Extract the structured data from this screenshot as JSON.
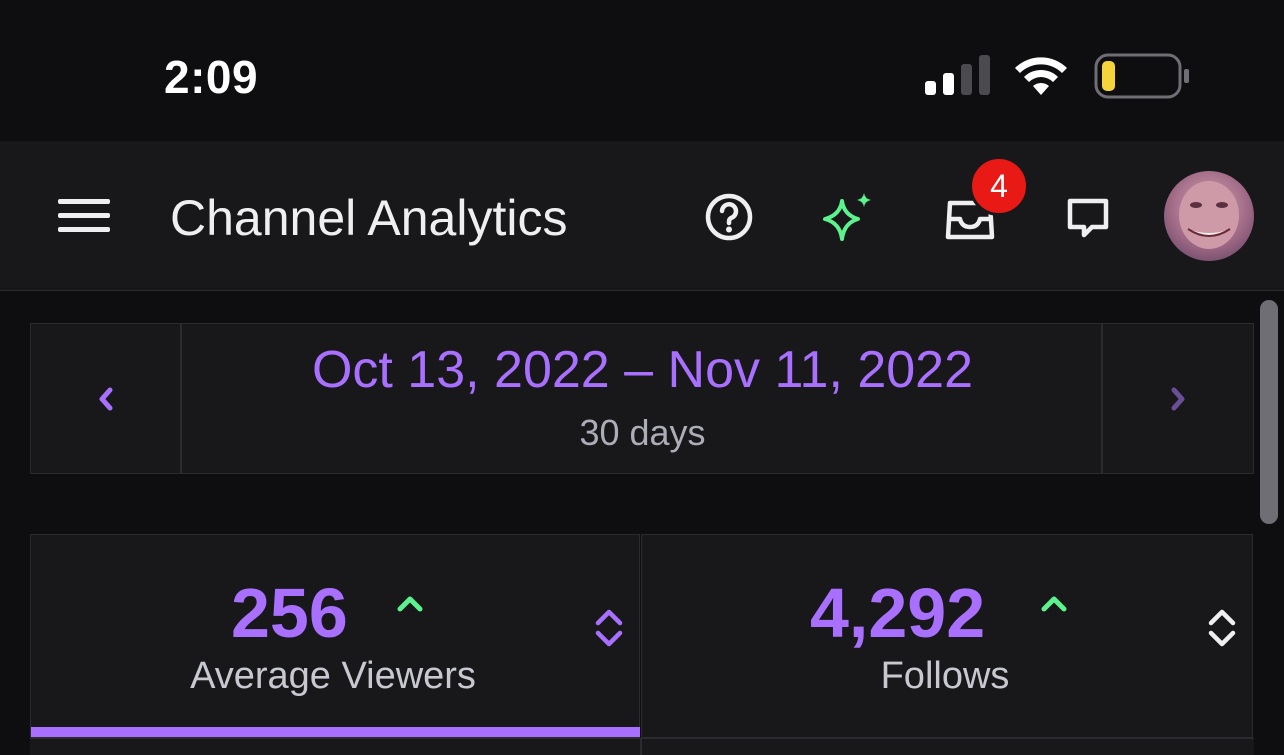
{
  "status_bar": {
    "time": "2:09",
    "signal_icon": "cellular-signal-icon",
    "wifi_icon": "wifi-icon",
    "battery_icon": "battery-low-icon",
    "battery_color": "#f5d33b"
  },
  "header": {
    "title": "Channel Analytics",
    "menu_icon": "hamburger-menu-icon",
    "help_icon": "help-circle-icon",
    "sparkle_icon": "sparkle-icon",
    "sparkle_color": "#5cf28e",
    "inbox_icon": "inbox-icon",
    "inbox_badge": "4",
    "badge_color": "#e91916",
    "chat_icon": "chat-bubble-icon"
  },
  "date_range": {
    "range": "Oct 13, 2022 – Nov 11, 2022",
    "duration": "30 days",
    "prev_icon": "chevron-left-icon",
    "next_icon": "chevron-right-icon"
  },
  "stats": [
    {
      "value": "256",
      "label": "Average Viewers",
      "trend_icon": "trend-up-icon",
      "sort_icon": "sort-icon",
      "active": true
    },
    {
      "value": "4,292",
      "label": "Follows",
      "trend_icon": "trend-up-icon",
      "sort_icon": "sort-icon",
      "active": false
    }
  ],
  "colors": {
    "accent": "#a970ff",
    "trend_up": "#5cf28e",
    "background": "#0e0e10",
    "surface": "#18181b"
  }
}
